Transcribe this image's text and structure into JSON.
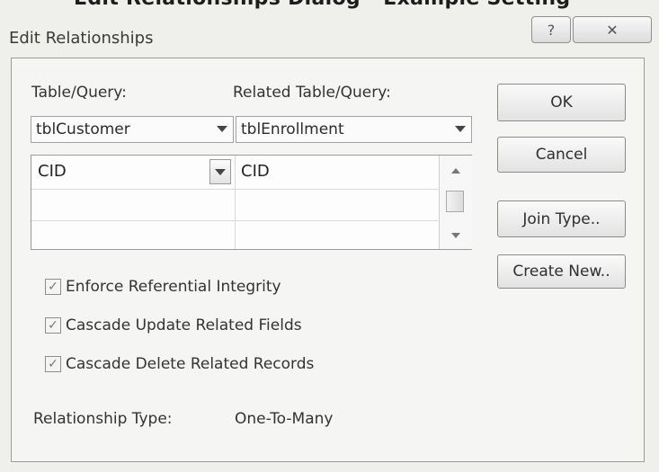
{
  "cropped_heading": "Edit Relationships Dialog - Example Setting",
  "dialog": {
    "title": "Edit Relationships",
    "help_glyph": "?",
    "close_glyph": "✕"
  },
  "left": {
    "table_label": "Table/Query:",
    "related_label": "Related Table/Query:",
    "table_value": "tblCustomer",
    "related_value": "tblEnrollment",
    "grid": {
      "rows": [
        {
          "left": "CID",
          "right": "CID"
        },
        {
          "left": "",
          "right": ""
        },
        {
          "left": "",
          "right": ""
        }
      ]
    },
    "checkboxes": [
      {
        "label": "Enforce Referential Integrity",
        "checked": true
      },
      {
        "label": "Cascade Update Related Fields",
        "checked": true
      },
      {
        "label": "Cascade Delete Related Records",
        "checked": true
      }
    ],
    "relationship_type_label": "Relationship Type:",
    "relationship_type_value": "One-To-Many"
  },
  "buttons": {
    "ok": "OK",
    "cancel": "Cancel",
    "join_type": "Join Type..",
    "create_new": "Create New.."
  },
  "check_glyph": "✓"
}
